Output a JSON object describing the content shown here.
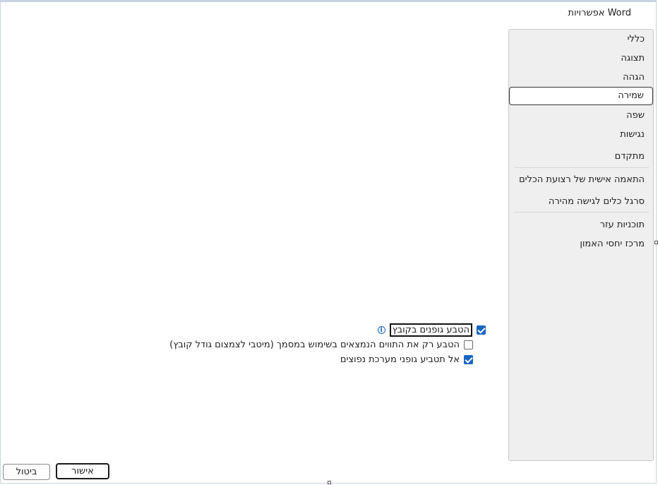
{
  "window": {
    "title": "אפשרויות Word"
  },
  "sidebar": {
    "items": [
      {
        "label": "כללי"
      },
      {
        "label": "תצוגה"
      },
      {
        "label": "הגהה"
      },
      {
        "label": "שמירה",
        "selected": true
      },
      {
        "label": "שפה"
      },
      {
        "label": "נגישות"
      },
      {
        "label": "מתקדם"
      },
      {
        "label": "התאמה אישית של רצועת הכלים"
      },
      {
        "label": "סרגל כלים לגישה מהירה"
      },
      {
        "label": "תוכניות עזר"
      },
      {
        "label": "מרכז יחסי האמון"
      }
    ]
  },
  "options": {
    "embed_fonts": {
      "label": "הטבע גופנים בקובץ",
      "checked": true
    },
    "embed_used_chars": {
      "label": "הטבע רק את התווים הנמצאים בשימוש במסמך (מיטבי לצמצום גודל קובץ)",
      "checked": false
    },
    "no_common_fonts": {
      "label": "אל תטביע גופני מערכת נפוצים",
      "checked": true
    }
  },
  "footer": {
    "ok_label": "אישור",
    "cancel_label": "ביטול"
  },
  "colors": {
    "accent": "#1766c2",
    "sidebar_bg": "#efefef"
  }
}
